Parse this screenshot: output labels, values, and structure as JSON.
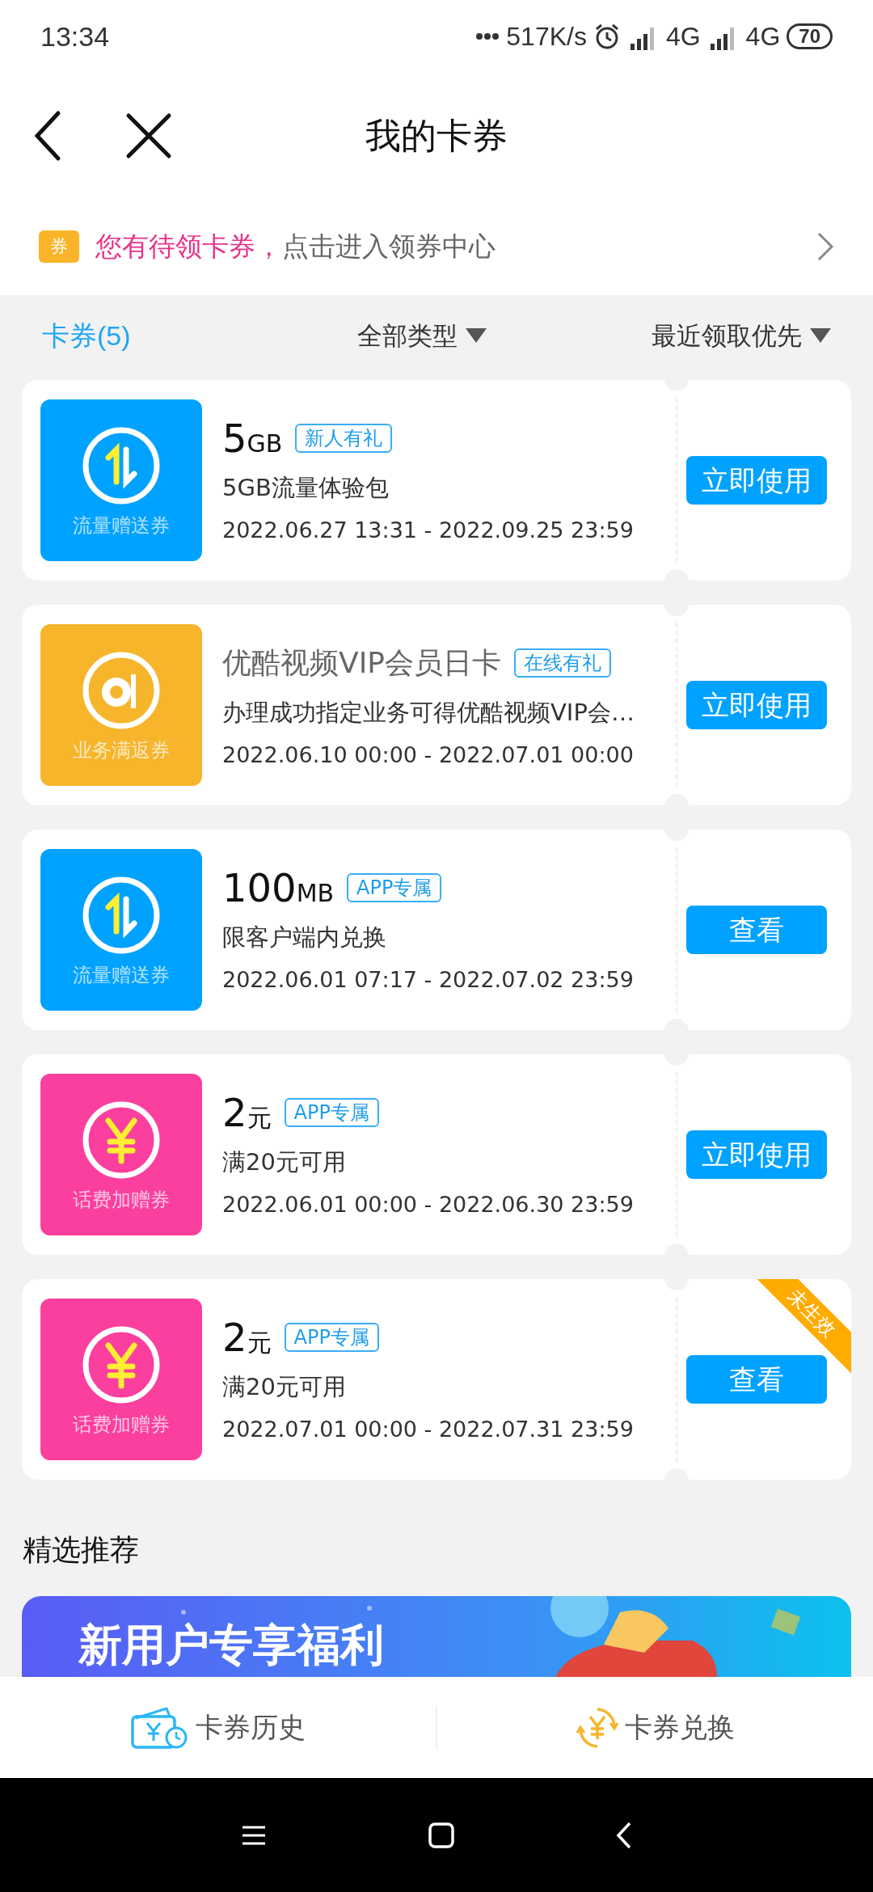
{
  "status_bar": {
    "time": "13:34",
    "speed": "517K/s",
    "network_1": "4G",
    "network_2": "4G",
    "battery": "70"
  },
  "header": {
    "title": "我的卡券"
  },
  "notice": {
    "badge": "券",
    "highlight": "您有待领卡券，",
    "text": "点击进入领券中心"
  },
  "filter_bar": {
    "count_label": "卡券(5)",
    "type_filter": "全部类型",
    "sort_filter": "最近领取优先"
  },
  "coupons": [
    {
      "kind": "data",
      "icon_label": "流量赠送券",
      "amount": "5",
      "unit": "GB",
      "tag": "新人有礼",
      "desc": "5GB流量体验包",
      "dates": "2022.06.27 13:31 - 2022.09.25 23:59",
      "button": "立即使用"
    },
    {
      "kind": "video",
      "icon_label": "业务满返券",
      "title": "优酷视频VIP会员日卡",
      "tag": "在线有礼",
      "desc": "办理成功指定业务可得优酷视频VIP会…",
      "dates": "2022.06.10 00:00 - 2022.07.01 00:00",
      "button": "立即使用"
    },
    {
      "kind": "data",
      "icon_label": "流量赠送券",
      "amount": "100",
      "unit": "MB",
      "tag": "APP专属",
      "desc": "限客户端内兑换",
      "dates": "2022.06.01 07:17 - 2022.07.02 23:59",
      "button": "查看"
    },
    {
      "kind": "money",
      "icon_label": "话费加赠券",
      "amount": "2",
      "unit": "元",
      "tag": "APP专属",
      "desc": "满20元可用",
      "dates": "2022.06.01 00:00 - 2022.06.30 23:59",
      "button": "立即使用"
    },
    {
      "kind": "money",
      "icon_label": "话费加赠券",
      "amount": "2",
      "unit": "元",
      "tag": "APP专属",
      "desc": "满20元可用",
      "dates": "2022.07.01 00:00 - 2022.07.31 23:59",
      "button": "查看",
      "ribbon": "未生效"
    }
  ],
  "recommend": {
    "title": "精选推荐",
    "banner_title": "新用户专享福利"
  },
  "bottom_bar": [
    {
      "kind": "history",
      "label": "卡券历史"
    },
    {
      "kind": "exchange",
      "label": "卡券兑换"
    }
  ]
}
